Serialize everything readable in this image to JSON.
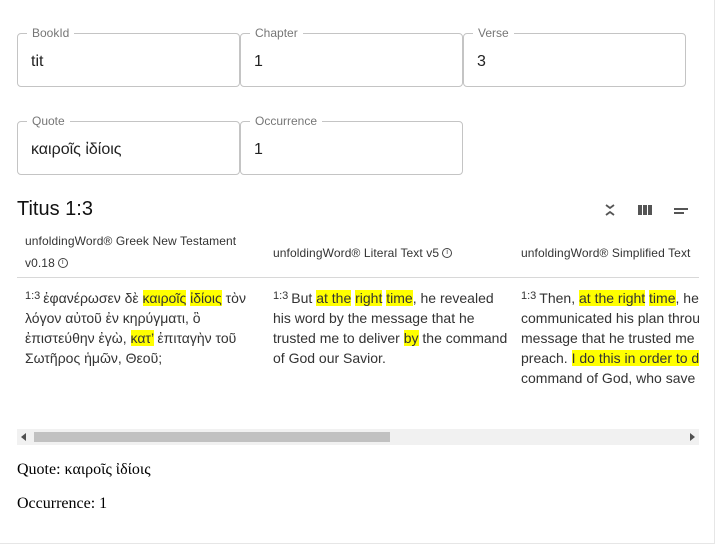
{
  "fields": {
    "bookId": {
      "label": "BookId",
      "value": "tit"
    },
    "chapter": {
      "label": "Chapter",
      "value": "1"
    },
    "verse": {
      "label": "Verse",
      "value": "3"
    },
    "quote": {
      "label": "Quote",
      "value": "καιροῖς ἰδίοις"
    },
    "occurrence": {
      "label": "Occurrence",
      "value": "1"
    }
  },
  "reference": "Titus 1:3",
  "toolbar_icons": [
    "collapse-icon",
    "columns-icon",
    "rows-icon"
  ],
  "panes": [
    {
      "title_line1": "unfoldingWord® Greek New Testament",
      "title_line2": "v0.18",
      "verse_num": "1:3",
      "lines": [
        [
          {
            "t": "ἐφανέρωσεν δὲ "
          },
          {
            "t": "καιροῖς",
            "h": true
          },
          {
            "t": " "
          },
          {
            "t": "ἰδίοις",
            "h": true
          },
          {
            "t": " τὸν"
          }
        ],
        [
          {
            "t": "λόγον αὐτοῦ ἐν κηρύγματι, ὃ"
          }
        ],
        [
          {
            "t": "ἐπιστεύθην ἐγὼ, "
          },
          {
            "t": "κατ’",
            "h": true
          },
          {
            "t": " ἐπιταγὴν τοῦ"
          }
        ],
        [
          {
            "t": "Σωτῆρος ἡμῶν, Θεοῦ;"
          }
        ]
      ]
    },
    {
      "title_line1": "unfoldingWord® Literal Text v5",
      "verse_num": "1:3",
      "lines": [
        [
          {
            "t": "But "
          },
          {
            "t": "at the",
            "h": true
          },
          {
            "t": " "
          },
          {
            "t": "right",
            "h": true
          },
          {
            "t": " "
          },
          {
            "t": "time",
            "h": true
          },
          {
            "t": ", he revealed"
          }
        ],
        [
          {
            "t": "his word by the message that he"
          }
        ],
        [
          {
            "t": "trusted me to deliver "
          },
          {
            "t": "by",
            "h": true
          },
          {
            "t": " the command"
          }
        ],
        [
          {
            "t": "of God our Savior."
          }
        ]
      ]
    },
    {
      "title_line1": "unfoldingWord® Simplified Text",
      "verse_num": "1:3",
      "lines": [
        [
          {
            "t": "Then, "
          },
          {
            "t": "at the right",
            "h": true
          },
          {
            "t": " "
          },
          {
            "t": "time",
            "h": true
          },
          {
            "t": ", he"
          }
        ],
        [
          {
            "t": "communicated his plan throu"
          }
        ],
        [
          {
            "t": "message that he trusted me"
          }
        ],
        [
          {
            "t": "preach. "
          },
          {
            "t": "I do this in order to d",
            "h": true
          }
        ],
        [
          {
            "t": "command of God, who save"
          }
        ]
      ]
    }
  ],
  "footer": {
    "quote": "Quote: καιροῖς ἰδίοις",
    "occurrence": "Occurrence: 1"
  }
}
